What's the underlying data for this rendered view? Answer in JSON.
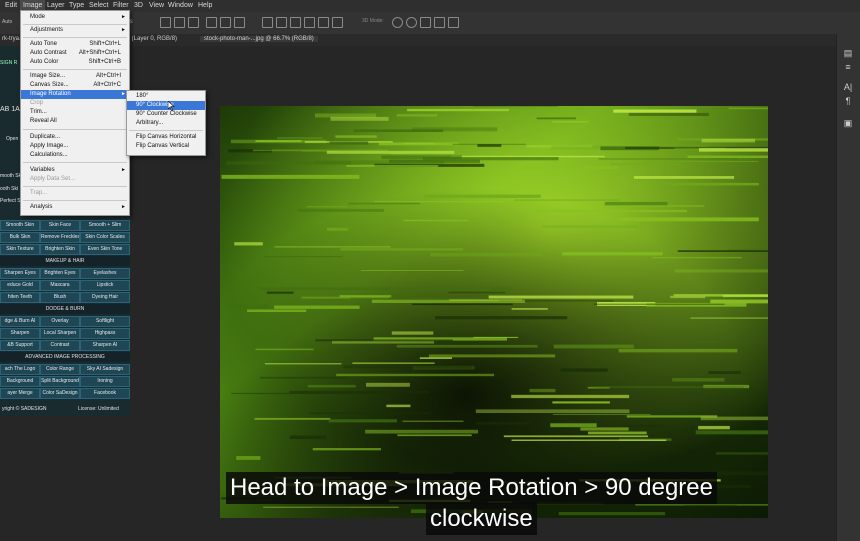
{
  "menubar": {
    "items": [
      "Edit",
      "Image",
      "Layer",
      "Type",
      "Select",
      "Filter",
      "3D",
      "View",
      "Window",
      "Help"
    ],
    "active": "Image"
  },
  "options": {
    "auto_label": "Auto",
    "controls_label": "ntrols",
    "mode_label": "3D Mode:"
  },
  "tabs": {
    "tab1": "rk-trya...",
    "tab1_tail": "33.3% (Layer 0, RGB/8)",
    "tab2": "stock-photo-man-...jpg @ 66.7% (RGB/8)"
  },
  "image_menu": {
    "items": [
      {
        "label": "Mode",
        "arrow": "►"
      },
      {
        "label": "Adjustments",
        "arrow": "►"
      },
      {
        "label": "Auto Tone",
        "shortcut": "Shift+Ctrl+L"
      },
      {
        "label": "Auto Contrast",
        "shortcut": "Alt+Shift+Ctrl+L"
      },
      {
        "label": "Auto Color",
        "shortcut": "Shift+Ctrl+B"
      },
      {
        "label": "Image Size...",
        "shortcut": "Alt+Ctrl+I"
      },
      {
        "label": "Canvas Size...",
        "shortcut": "Alt+Ctrl+C"
      },
      {
        "label": "Image Rotation",
        "arrow": "►"
      },
      {
        "label": "Crop"
      },
      {
        "label": "Trim..."
      },
      {
        "label": "Reveal All"
      },
      {
        "label": "Duplicate..."
      },
      {
        "label": "Apply Image..."
      },
      {
        "label": "Calculations..."
      },
      {
        "label": "Variables",
        "arrow": "►"
      },
      {
        "label": "Apply Data Set..."
      },
      {
        "label": "Trap..."
      },
      {
        "label": "Analysis",
        "arrow": "►"
      }
    ]
  },
  "rotation_submenu": {
    "items": [
      "180°",
      "90° Clockwise",
      "90° Counter Clockwise",
      "Arbitrary...",
      "Flip Canvas Horizontal",
      "Flip Canvas Vertical"
    ],
    "highlighted": "90° Clockwise"
  },
  "panel": {
    "title_partial": "SIGN R",
    "tab_partial": "AB 1A -",
    "open_label": "Open",
    "side_labels": [
      "mooth Ski",
      "ooth Ski",
      "Perfect Sk"
    ],
    "rows1": [
      [
        "Smooth Skin",
        "Skin Face",
        "Smooth + Slim"
      ],
      [
        "Bulk Skin",
        "Remove Freckles",
        "Skin Color Scales"
      ],
      [
        "Skin Texture",
        "Brighten Skin",
        "Even Skin Tone"
      ]
    ],
    "section_makeup": "MAKEUP & HAIR",
    "rows2": [
      [
        "Sharpen Eyes",
        "Brighten Eyes",
        "Eyelashes"
      ],
      [
        "educe Gold",
        "Mascara",
        "Lipstick"
      ],
      [
        "hiten Teeth",
        "Blush",
        "Dyeing Hair"
      ]
    ],
    "section_dodge": "DODGE & BURN",
    "rows3": [
      [
        "dge & Burn AI",
        "Overlay",
        "Softlight"
      ],
      [
        "Sharpen",
        "Local Sharpen",
        "Highpass"
      ],
      [
        "&B Support",
        "Contrast",
        "Sharpen AI"
      ]
    ],
    "section_adv": "ADVANCED IMAGE PROCESSING",
    "rows4": [
      [
        "ach The Logo",
        "Color Range",
        "Sky AI Sadesign"
      ],
      [
        "Background",
        "Split Background",
        "Ironing"
      ],
      [
        "ayer Merge",
        "Color SaDesign",
        "Facebook"
      ]
    ],
    "copyright": "yright © SADESIGN",
    "license": "License: Unlimited"
  },
  "caption": {
    "line1": "Head to Image > Image Rotation > 90 degree",
    "line2": "clockwise"
  },
  "colors": {
    "menu_highlight": "#3b77d6",
    "panel_button": "#1f4655",
    "foliage": "#7fbf1f"
  }
}
